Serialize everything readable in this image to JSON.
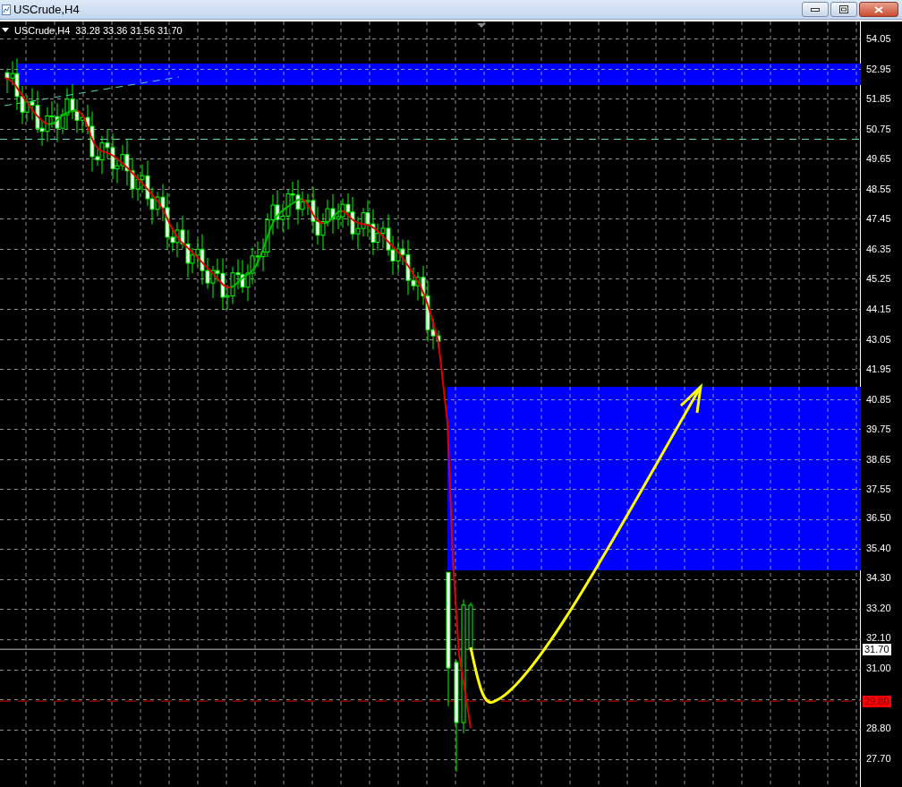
{
  "window": {
    "title": "USCrude,H4"
  },
  "chart_header": {
    "symbol": "USCrude,H4",
    "ohlc": "33.28 33.36 31.56 31.70"
  },
  "price_axis": [
    "54.05",
    "52.95",
    "51.85",
    "50.75",
    "49.65",
    "48.55",
    "47.45",
    "46.35",
    "45.25",
    "44.15",
    "43.05",
    "41.95",
    "40.85",
    "39.75",
    "38.65",
    "37.55",
    "36.50",
    "35.40",
    "34.30",
    "33.20",
    "32.10",
    "31.00",
    "28.80",
    "27.70"
  ],
  "price_markers": [
    {
      "kind": "bid",
      "label": "31.70"
    },
    {
      "kind": "level",
      "label": "29.80"
    }
  ]
}
